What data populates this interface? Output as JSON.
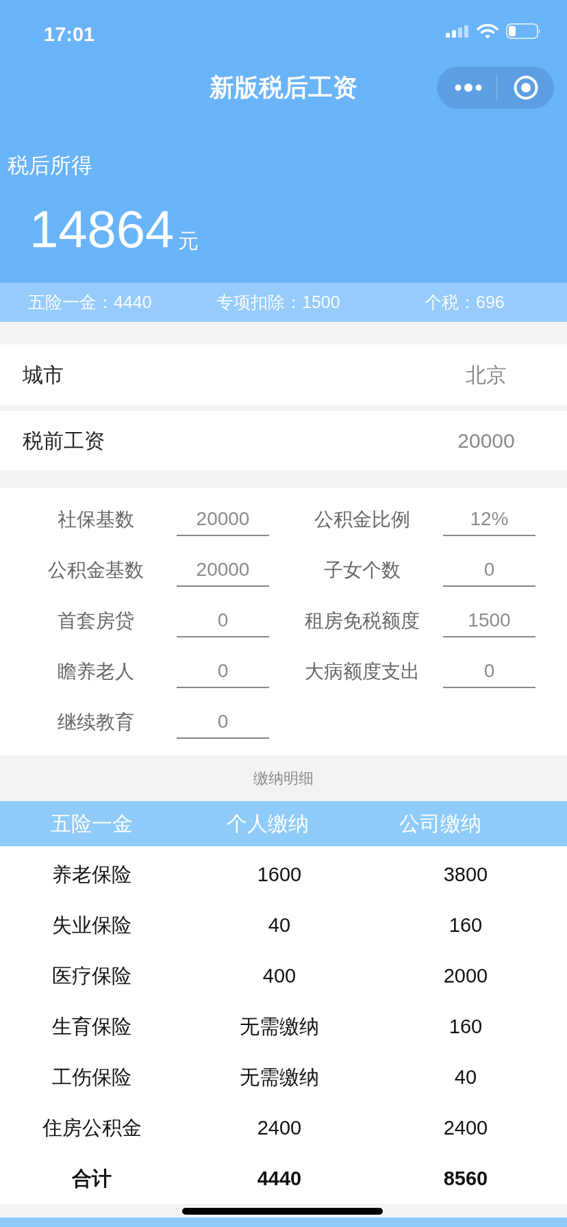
{
  "status_bar": {
    "time": "17:01"
  },
  "nav_bar": {
    "title": "新版税后工资"
  },
  "summary": {
    "label": "税后所得",
    "amount": "14864",
    "unit": "元",
    "stats": [
      "五险一金：4440",
      "专项扣除：1500",
      "个税：696"
    ]
  },
  "basics": [
    {
      "label": "城市",
      "value": "北京"
    },
    {
      "label": "税前工资",
      "value": "20000"
    }
  ],
  "params": [
    {
      "label": "社保基数",
      "value": "20000"
    },
    {
      "label": "公积金比例",
      "value": "12%"
    },
    {
      "label": "公积金基数",
      "value": "20000"
    },
    {
      "label": "子女个数",
      "value": "0"
    },
    {
      "label": "首套房贷",
      "value": "0"
    },
    {
      "label": "租房免税额度",
      "value": "1500"
    },
    {
      "label": "瞻养老人",
      "value": "0"
    },
    {
      "label": "大病额度支出",
      "value": "0"
    },
    {
      "label": "继续教育",
      "value": "0"
    }
  ],
  "details": {
    "title": "缴纳明细",
    "columns": [
      "五险一金",
      "个人缴纳",
      "公司缴纳"
    ],
    "rows": [
      [
        "养老保险",
        "1600",
        "3800"
      ],
      [
        "失业保险",
        "40",
        "160"
      ],
      [
        "医疗保险",
        "400",
        "2000"
      ],
      [
        "生育保险",
        "无需缴纳",
        "160"
      ],
      [
        "工伤保险",
        "无需缴纳",
        "40"
      ],
      [
        "住房公积金",
        "2400",
        "2400"
      ]
    ],
    "total": [
      "合计",
      "4440",
      "8560"
    ]
  }
}
